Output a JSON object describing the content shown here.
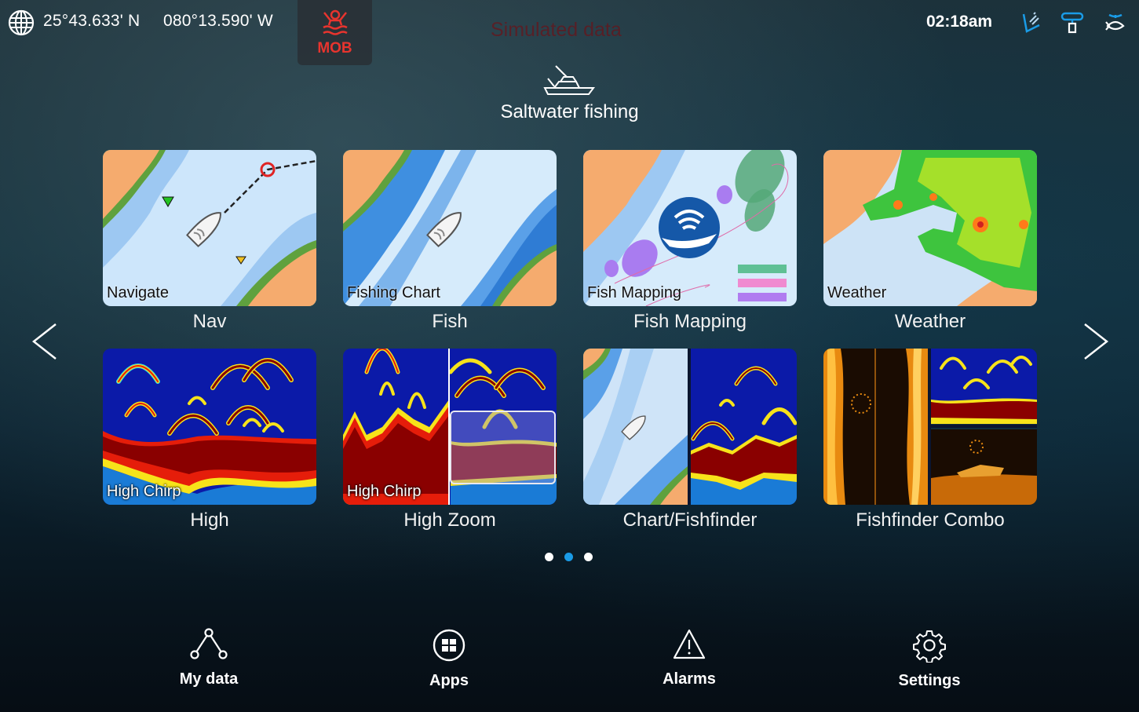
{
  "status_bar": {
    "latitude": "25°43.633' N",
    "longitude": "080°13.590' W",
    "mob_label": "MOB",
    "simulated_label": "Simulated data",
    "time": "02:18am",
    "icons": [
      "globe-icon",
      "mob-icon",
      "autopilot-icon",
      "radar-icon",
      "fishfinder-icon"
    ],
    "colors": {
      "mob": "#e8342e",
      "status_icon": "#1a9be6",
      "sim_text": "#6b1218"
    }
  },
  "profile": {
    "icon": "sport-fishing-boat-icon",
    "title": "Saltwater fishing"
  },
  "apps": [
    {
      "thumb_label": "Navigate",
      "title": "Nav"
    },
    {
      "thumb_label": "Fishing Chart",
      "title": "Fish"
    },
    {
      "thumb_label": "Fish Mapping",
      "title": "Fish Mapping"
    },
    {
      "thumb_label": "Weather",
      "title": "Weather"
    },
    {
      "thumb_label": "High Chirp",
      "title": "High"
    },
    {
      "thumb_label": "High Chirp",
      "title": "High Zoom"
    },
    {
      "thumb_label": "",
      "title": "Chart/Fishfinder"
    },
    {
      "thumb_label": "",
      "title": "Fishfinder Combo"
    }
  ],
  "pagination": {
    "pages": 3,
    "current": 2
  },
  "nav": {
    "prev_icon": "chevron-left-icon",
    "next_icon": "chevron-right-icon"
  },
  "bottom_nav": [
    {
      "label": "My data",
      "icon": "share-nodes-icon"
    },
    {
      "label": "Apps",
      "icon": "apps-grid-icon"
    },
    {
      "label": "Alarms",
      "icon": "warning-triangle-icon"
    },
    {
      "label": "Settings",
      "icon": "gear-icon"
    }
  ]
}
